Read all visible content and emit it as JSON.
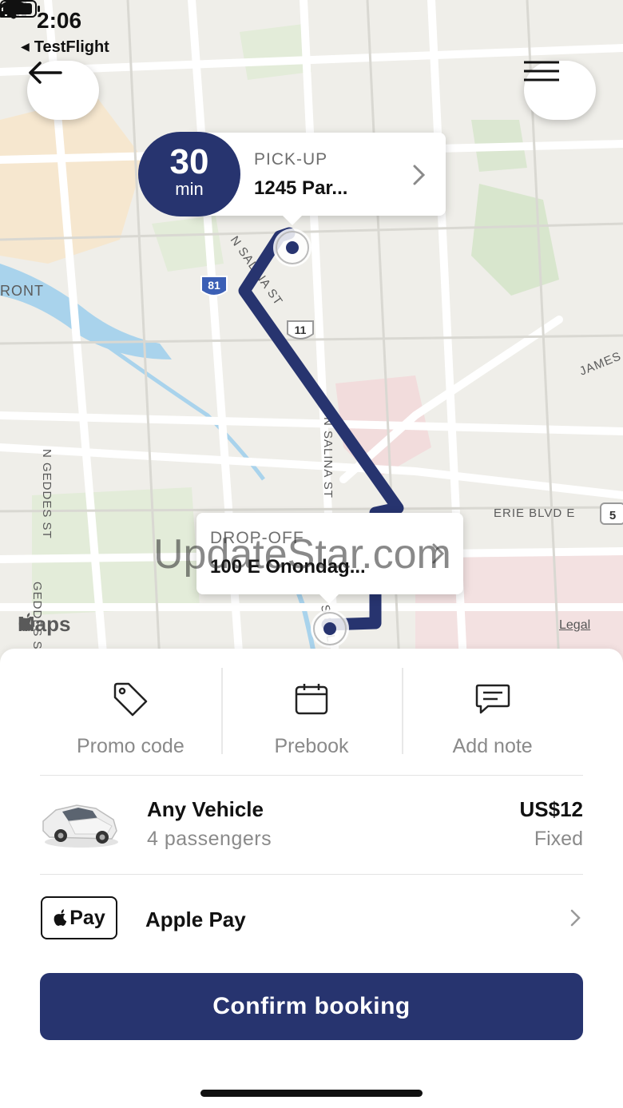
{
  "status_bar": {
    "time": "2:06",
    "back_app": "TestFlight"
  },
  "map": {
    "street_labels": {
      "n_salina_st_1": "N SALINA ST",
      "n_salina_st_2": "N SALINA ST",
      "n_geddes_st": "N GEDDES ST",
      "erie_blvd": "ERIE BLVD E",
      "james": "JAMES",
      "front": "RONT",
      "i81": "81",
      "us11": "11",
      "ny5": "5",
      "s_salina": "S SAL",
      "geddes_lower": "GEDDES ST"
    },
    "route_color": "#27346f",
    "attribution": "Maps",
    "legal": "Legal",
    "watermark": "UpdateStar.com"
  },
  "pickup": {
    "eta_value": "30",
    "eta_unit": "min",
    "label": "PICK-UP",
    "address": "1245 Par..."
  },
  "dropoff": {
    "label": "DROP-OFF",
    "address": "100 E Onondag..."
  },
  "actions": [
    {
      "label": "Promo code",
      "icon": "tag-icon"
    },
    {
      "label": "Prebook",
      "icon": "calendar-icon"
    },
    {
      "label": "Add note",
      "icon": "message-icon"
    }
  ],
  "vehicle": {
    "name": "Any Vehicle",
    "passengers": "4 passengers",
    "price": "US$12",
    "price_type": "Fixed"
  },
  "payment": {
    "badge": "Pay",
    "name": "Apple Pay"
  },
  "confirm_label": "Confirm booking",
  "colors": {
    "accent": "#27346f"
  }
}
